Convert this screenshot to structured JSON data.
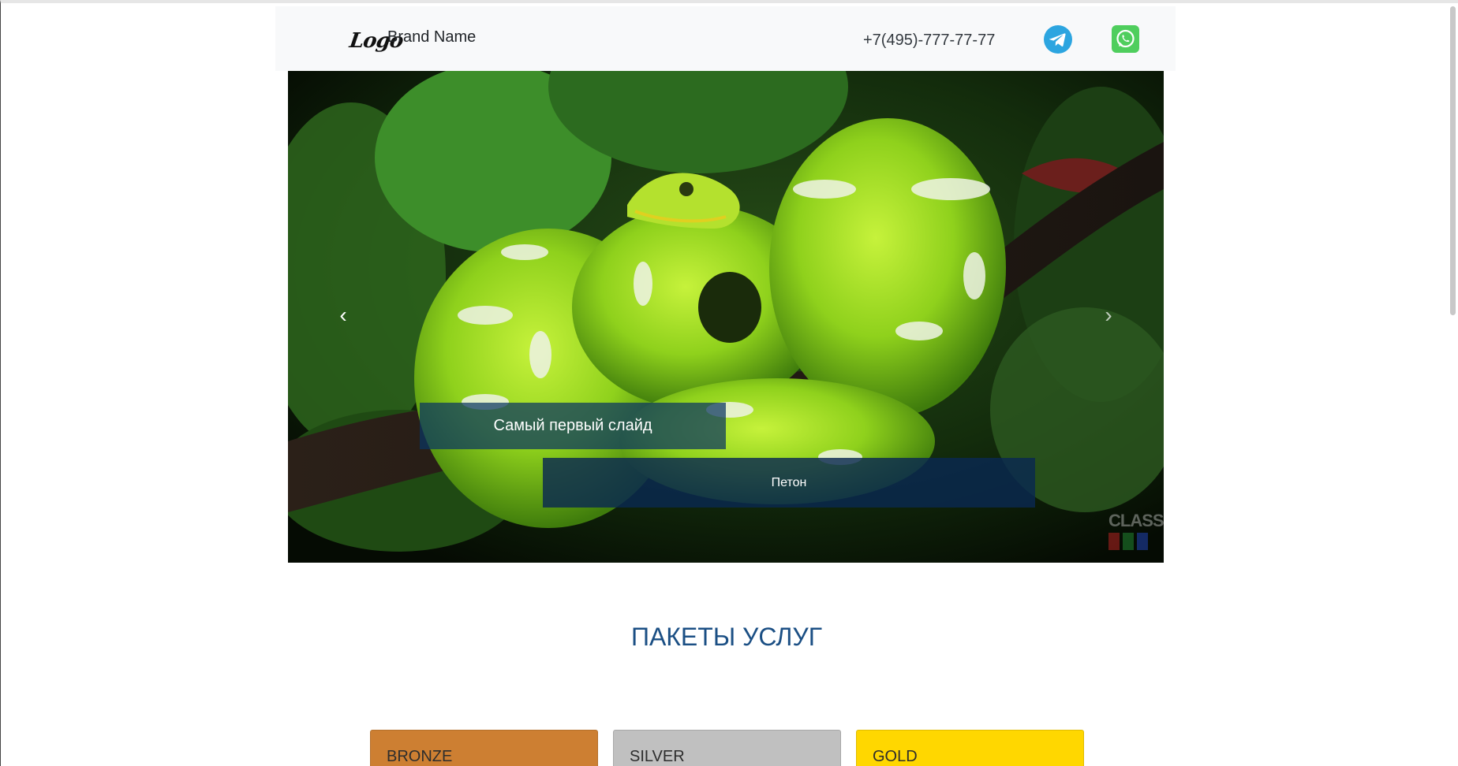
{
  "header": {
    "logo_text": "Logo",
    "brand_name": "Brand Name",
    "phone": "+7(495)-777-77-77",
    "icons": [
      "telegram-icon",
      "whatsapp-icon"
    ],
    "background": "#f8f9fa"
  },
  "carousel": {
    "slide_title": "Самый первый слайд",
    "slide_subtitle": "Петон",
    "prev_icon": "‹",
    "next_icon": "›",
    "watermark": "CLASS"
  },
  "section": {
    "title": "ПАКЕТЫ УСЛУГ",
    "title_color": "#1b4f84"
  },
  "packages": [
    {
      "label": "BRONZE",
      "color": "#cd7f32"
    },
    {
      "label": "SILVER",
      "color": "#c0c0c0"
    },
    {
      "label": "GOLD",
      "color": "#ffd700"
    }
  ]
}
